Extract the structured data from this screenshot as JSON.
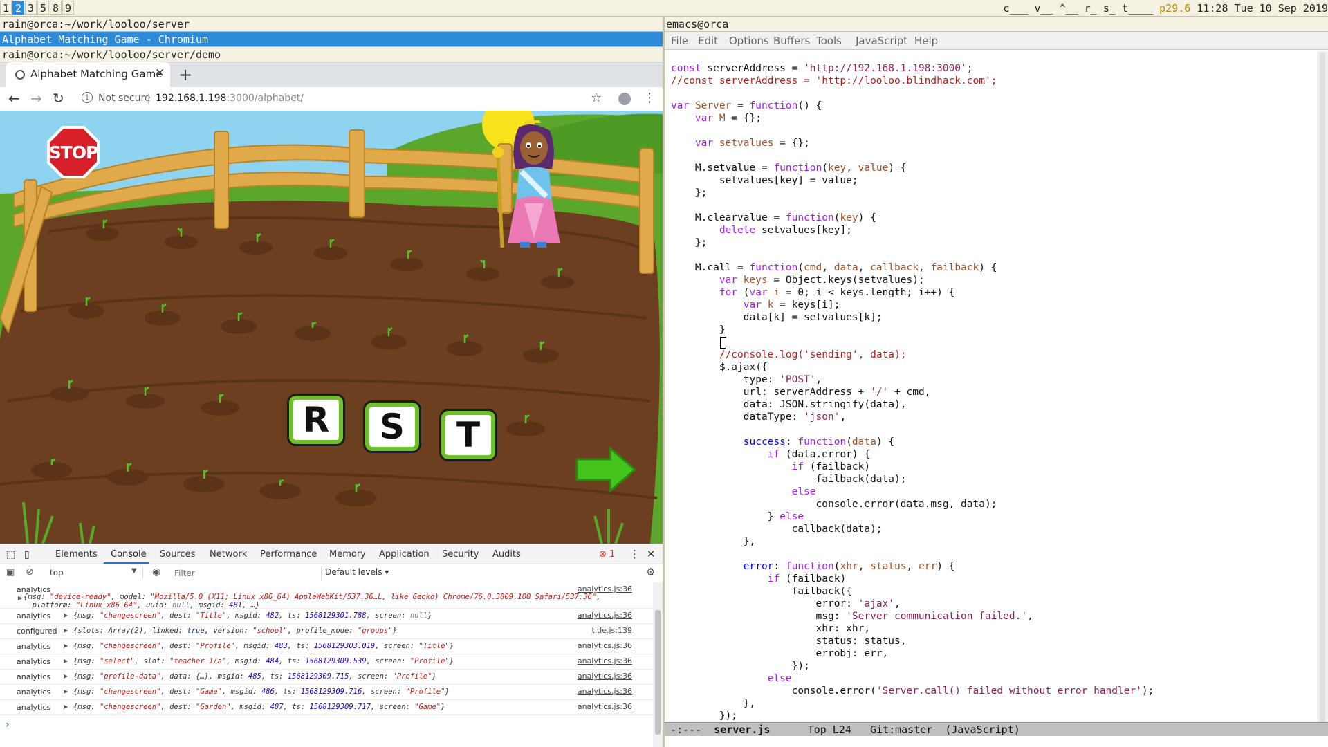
{
  "topbar": {
    "workspaces": [
      "1",
      "2",
      "3",
      "5",
      "8",
      "9"
    ],
    "active_workspace": "2",
    "status_prefix": "c___ v__ ^__ r_ s_ t____ ",
    "cpu": "p29.6",
    "clock": "11:28 Tue 10 Sep 2019"
  },
  "left": {
    "term1_title": "rain@orca:~/work/looloo/server",
    "chrome_window_title": "Alphabet Matching Game - Chromium",
    "term2_title": "rain@orca:~/work/looloo/server/demo"
  },
  "browser": {
    "tab_title": "Alphabet Matching Game",
    "not_secure": "Not secure",
    "url_host": "192.168.1.198",
    "url_rest": ":3000/alphabet/"
  },
  "game": {
    "stop_sign": "STOP",
    "letters": [
      "R",
      "S",
      "T"
    ],
    "colors": {
      "sky": "#8ed3f0",
      "grass": "#5aa72b",
      "dirt": "#6b3f1f",
      "fence": "#f2c24e",
      "tile_border": "#6ec12b",
      "arrow": "#45c41e"
    }
  },
  "devtools": {
    "tabs": [
      "Elements",
      "Console",
      "Sources",
      "Network",
      "Performance",
      "Memory",
      "Application",
      "Security",
      "Audits"
    ],
    "active_tab": "Console",
    "error_count": "1",
    "context": "top",
    "filter_placeholder": "Filter",
    "levels": "Default levels ▾",
    "logs": [
      {
        "label": "analytics",
        "src": "analytics.js:36",
        "parts": [
          [
            "t",
            "{msg: "
          ],
          [
            "s",
            "\"device-ready\""
          ],
          [
            "t",
            ", model: "
          ],
          [
            "s",
            "\"Mozilla/5.0 (X11; Linux x86_64) AppleWebKit/537.36…L, like Gecko) Chrome/76.0.3809.100 Safari/537.36\""
          ],
          [
            "t",
            ",\n  platform: "
          ],
          [
            "s",
            "\"Linux x86_64\""
          ],
          [
            "t",
            ", uuid: "
          ],
          [
            "nl",
            "null"
          ],
          [
            "t",
            ", msgid: "
          ],
          [
            "n",
            "481"
          ],
          [
            "t",
            ", …}"
          ]
        ]
      },
      {
        "label": "analytics",
        "src": "analytics.js:36",
        "parts": [
          [
            "t",
            "{msg: "
          ],
          [
            "s",
            "\"changescreen\""
          ],
          [
            "t",
            ", dest: "
          ],
          [
            "s",
            "\"Title\""
          ],
          [
            "t",
            ", msgid: "
          ],
          [
            "n",
            "482"
          ],
          [
            "t",
            ", ts: "
          ],
          [
            "n",
            "1568129301.788"
          ],
          [
            "t",
            ", screen: "
          ],
          [
            "nl",
            "null"
          ],
          [
            "t",
            "}"
          ]
        ]
      },
      {
        "label": "configured",
        "src": "title.js:139",
        "parts": [
          [
            "t",
            "{slots: Array(2), linked: "
          ],
          [
            "k",
            "true"
          ],
          [
            "t",
            ", version: "
          ],
          [
            "s",
            "\"school\""
          ],
          [
            "t",
            ", profile_mode: "
          ],
          [
            "s",
            "\"groups\""
          ],
          [
            "t",
            "}"
          ]
        ]
      },
      {
        "label": "analytics",
        "src": "analytics.js:36",
        "parts": [
          [
            "t",
            "{msg: "
          ],
          [
            "s",
            "\"changescreen\""
          ],
          [
            "t",
            ", dest: "
          ],
          [
            "s",
            "\"Profile\""
          ],
          [
            "t",
            ", msgid: "
          ],
          [
            "n",
            "483"
          ],
          [
            "t",
            ", ts: "
          ],
          [
            "n",
            "1568129303.019"
          ],
          [
            "t",
            ", screen: "
          ],
          [
            "s",
            "\"Title\""
          ],
          [
            "t",
            "}"
          ]
        ]
      },
      {
        "label": "analytics",
        "src": "analytics.js:36",
        "parts": [
          [
            "t",
            "{msg: "
          ],
          [
            "s",
            "\"select\""
          ],
          [
            "t",
            ", slot: "
          ],
          [
            "s",
            "\"teacher 1/a\""
          ],
          [
            "t",
            ", msgid: "
          ],
          [
            "n",
            "484"
          ],
          [
            "t",
            ", ts: "
          ],
          [
            "n",
            "1568129309.539"
          ],
          [
            "t",
            ", screen: "
          ],
          [
            "s",
            "\"Profile\""
          ],
          [
            "t",
            "}"
          ]
        ]
      },
      {
        "label": "analytics",
        "src": "analytics.js:36",
        "parts": [
          [
            "t",
            "{msg: "
          ],
          [
            "s",
            "\"profile-data\""
          ],
          [
            "t",
            ", data: {…}, msgid: "
          ],
          [
            "n",
            "485"
          ],
          [
            "t",
            ", ts: "
          ],
          [
            "n",
            "1568129309.715"
          ],
          [
            "t",
            ", screen: "
          ],
          [
            "s",
            "\"Profile\""
          ],
          [
            "t",
            "}"
          ]
        ]
      },
      {
        "label": "analytics",
        "src": "analytics.js:36",
        "parts": [
          [
            "t",
            "{msg: "
          ],
          [
            "s",
            "\"changescreen\""
          ],
          [
            "t",
            ", dest: "
          ],
          [
            "s",
            "\"Game\""
          ],
          [
            "t",
            ", msgid: "
          ],
          [
            "n",
            "486"
          ],
          [
            "t",
            ", ts: "
          ],
          [
            "n",
            "1568129309.716"
          ],
          [
            "t",
            ", screen: "
          ],
          [
            "s",
            "\"Profile\""
          ],
          [
            "t",
            "}"
          ]
        ]
      },
      {
        "label": "analytics",
        "src": "analytics.js:36",
        "parts": [
          [
            "t",
            "{msg: "
          ],
          [
            "s",
            "\"changescreen\""
          ],
          [
            "t",
            ", dest: "
          ],
          [
            "s",
            "\"Garden\""
          ],
          [
            "t",
            ", msgid: "
          ],
          [
            "n",
            "487"
          ],
          [
            "t",
            ", ts: "
          ],
          [
            "n",
            "1568129309.717"
          ],
          [
            "t",
            ", screen: "
          ],
          [
            "s",
            "\"Game\""
          ],
          [
            "t",
            "}"
          ]
        ]
      }
    ],
    "prompt": "›"
  },
  "emacs": {
    "title": "emacs@orca",
    "menu": [
      "File",
      "Edit",
      "Options",
      "Buffers",
      "Tools",
      "JavaScript",
      "Help"
    ],
    "code": [
      [
        [
          "kw",
          "const"
        ],
        [
          "t",
          " serverAddress = "
        ],
        [
          "str",
          "'http://192.168.1.198:3000'"
        ],
        [
          "t",
          ";"
        ]
      ],
      [
        [
          "cm",
          "//const serverAddress = 'http://looloo.blindhack.com';"
        ]
      ],
      [],
      [
        [
          "kw",
          "var"
        ],
        [
          "t",
          " "
        ],
        [
          "var",
          "Server"
        ],
        [
          "t",
          " = "
        ],
        [
          "kw",
          "function"
        ],
        [
          "t",
          "() {"
        ]
      ],
      [
        [
          "t",
          "    "
        ],
        [
          "kw",
          "var"
        ],
        [
          "t",
          " "
        ],
        [
          "var",
          "M"
        ],
        [
          "t",
          " = {};"
        ]
      ],
      [],
      [
        [
          "t",
          "    "
        ],
        [
          "kw",
          "var"
        ],
        [
          "t",
          " "
        ],
        [
          "var",
          "setvalues"
        ],
        [
          "t",
          " = {};"
        ]
      ],
      [],
      [
        [
          "t",
          "    M.setvalue = "
        ],
        [
          "kw",
          "function"
        ],
        [
          "t",
          "("
        ],
        [
          "var",
          "key"
        ],
        [
          "t",
          ", "
        ],
        [
          "var",
          "value"
        ],
        [
          "t",
          ") {"
        ]
      ],
      [
        [
          "t",
          "        setvalues[key] = value;"
        ]
      ],
      [
        [
          "t",
          "    };"
        ]
      ],
      [],
      [
        [
          "t",
          "    M.clearvalue = "
        ],
        [
          "kw",
          "function"
        ],
        [
          "t",
          "("
        ],
        [
          "var",
          "key"
        ],
        [
          "t",
          ") {"
        ]
      ],
      [
        [
          "t",
          "        "
        ],
        [
          "kw",
          "delete"
        ],
        [
          "t",
          " setvalues[key];"
        ]
      ],
      [
        [
          "t",
          "    };"
        ]
      ],
      [],
      [
        [
          "t",
          "    M.call = "
        ],
        [
          "kw",
          "function"
        ],
        [
          "t",
          "("
        ],
        [
          "var",
          "cmd"
        ],
        [
          "t",
          ", "
        ],
        [
          "var",
          "data"
        ],
        [
          "t",
          ", "
        ],
        [
          "var",
          "callback"
        ],
        [
          "t",
          ", "
        ],
        [
          "var",
          "failback"
        ],
        [
          "t",
          ") {"
        ]
      ],
      [
        [
          "t",
          "        "
        ],
        [
          "kw",
          "var"
        ],
        [
          "t",
          " "
        ],
        [
          "var",
          "keys"
        ],
        [
          "t",
          " = Object.keys(setvalues);"
        ]
      ],
      [
        [
          "t",
          "        "
        ],
        [
          "kw",
          "for"
        ],
        [
          "t",
          " ("
        ],
        [
          "kw",
          "var"
        ],
        [
          "t",
          " "
        ],
        [
          "var",
          "i"
        ],
        [
          "t",
          " = 0; i < keys.length; i++) {"
        ]
      ],
      [
        [
          "t",
          "            "
        ],
        [
          "kw",
          "var"
        ],
        [
          "t",
          " "
        ],
        [
          "var",
          "k"
        ],
        [
          "t",
          " = keys[i];"
        ]
      ],
      [
        [
          "t",
          "            data[k] = setvalues[k];"
        ]
      ],
      [
        [
          "t",
          "        }"
        ]
      ],
      [],
      [
        [
          "t",
          "        "
        ],
        [
          "cm",
          "//console.log('sending', data);"
        ]
      ],
      [
        [
          "t",
          "        $.ajax({"
        ]
      ],
      [
        [
          "t",
          "            type: "
        ],
        [
          "str",
          "'POST'"
        ],
        [
          "t",
          ","
        ]
      ],
      [
        [
          "t",
          "            url: serverAddress + "
        ],
        [
          "str",
          "'/'"
        ],
        [
          "t",
          " + cmd,"
        ]
      ],
      [
        [
          "t",
          "            data: JSON.stringify(data),"
        ]
      ],
      [
        [
          "t",
          "            dataType: "
        ],
        [
          "str",
          "'json'"
        ],
        [
          "t",
          ","
        ]
      ],
      [],
      [
        [
          "t",
          "            "
        ],
        [
          "fn",
          "success"
        ],
        [
          "t",
          ": "
        ],
        [
          "kw",
          "function"
        ],
        [
          "t",
          "("
        ],
        [
          "var",
          "data"
        ],
        [
          "t",
          ") {"
        ]
      ],
      [
        [
          "t",
          "                "
        ],
        [
          "kw",
          "if"
        ],
        [
          "t",
          " (data.error) {"
        ]
      ],
      [
        [
          "t",
          "                    "
        ],
        [
          "kw",
          "if"
        ],
        [
          "t",
          " (failback)"
        ]
      ],
      [
        [
          "t",
          "                        failback(data);"
        ]
      ],
      [
        [
          "t",
          "                    "
        ],
        [
          "kw",
          "else"
        ]
      ],
      [
        [
          "t",
          "                        console.error(data.msg, data);"
        ]
      ],
      [
        [
          "t",
          "                } "
        ],
        [
          "kw",
          "else"
        ]
      ],
      [
        [
          "t",
          "                    callback(data);"
        ]
      ],
      [
        [
          "t",
          "            },"
        ]
      ],
      [],
      [
        [
          "t",
          "            "
        ],
        [
          "fn",
          "error"
        ],
        [
          "t",
          ": "
        ],
        [
          "kw",
          "function"
        ],
        [
          "t",
          "("
        ],
        [
          "var",
          "xhr"
        ],
        [
          "t",
          ", "
        ],
        [
          "var",
          "status"
        ],
        [
          "t",
          ", "
        ],
        [
          "var",
          "err"
        ],
        [
          "t",
          ") {"
        ]
      ],
      [
        [
          "t",
          "                "
        ],
        [
          "kw",
          "if"
        ],
        [
          "t",
          " (failback)"
        ]
      ],
      [
        [
          "t",
          "                    failback({"
        ]
      ],
      [
        [
          "t",
          "                        error: "
        ],
        [
          "str",
          "'ajax'"
        ],
        [
          "t",
          ","
        ]
      ],
      [
        [
          "t",
          "                        msg: "
        ],
        [
          "str",
          "'Server communication failed.'"
        ],
        [
          "t",
          ","
        ]
      ],
      [
        [
          "t",
          "                        xhr: xhr,"
        ]
      ],
      [
        [
          "t",
          "                        status: status,"
        ]
      ],
      [
        [
          "t",
          "                        errobj: err,"
        ]
      ],
      [
        [
          "t",
          "                    });"
        ]
      ],
      [
        [
          "t",
          "                "
        ],
        [
          "kw",
          "else"
        ]
      ],
      [
        [
          "t",
          "                    console.error("
        ],
        [
          "str",
          "'Server.call() failed without error handler'"
        ],
        [
          "t",
          ");"
        ]
      ],
      [
        [
          "t",
          "            },"
        ]
      ],
      [
        [
          "t",
          "        });"
        ]
      ]
    ],
    "modeline": {
      "state": "-:---",
      "buffer": "server.js",
      "position": "Top L24",
      "vc": "Git:master",
      "mode": "(JavaScript)"
    }
  }
}
